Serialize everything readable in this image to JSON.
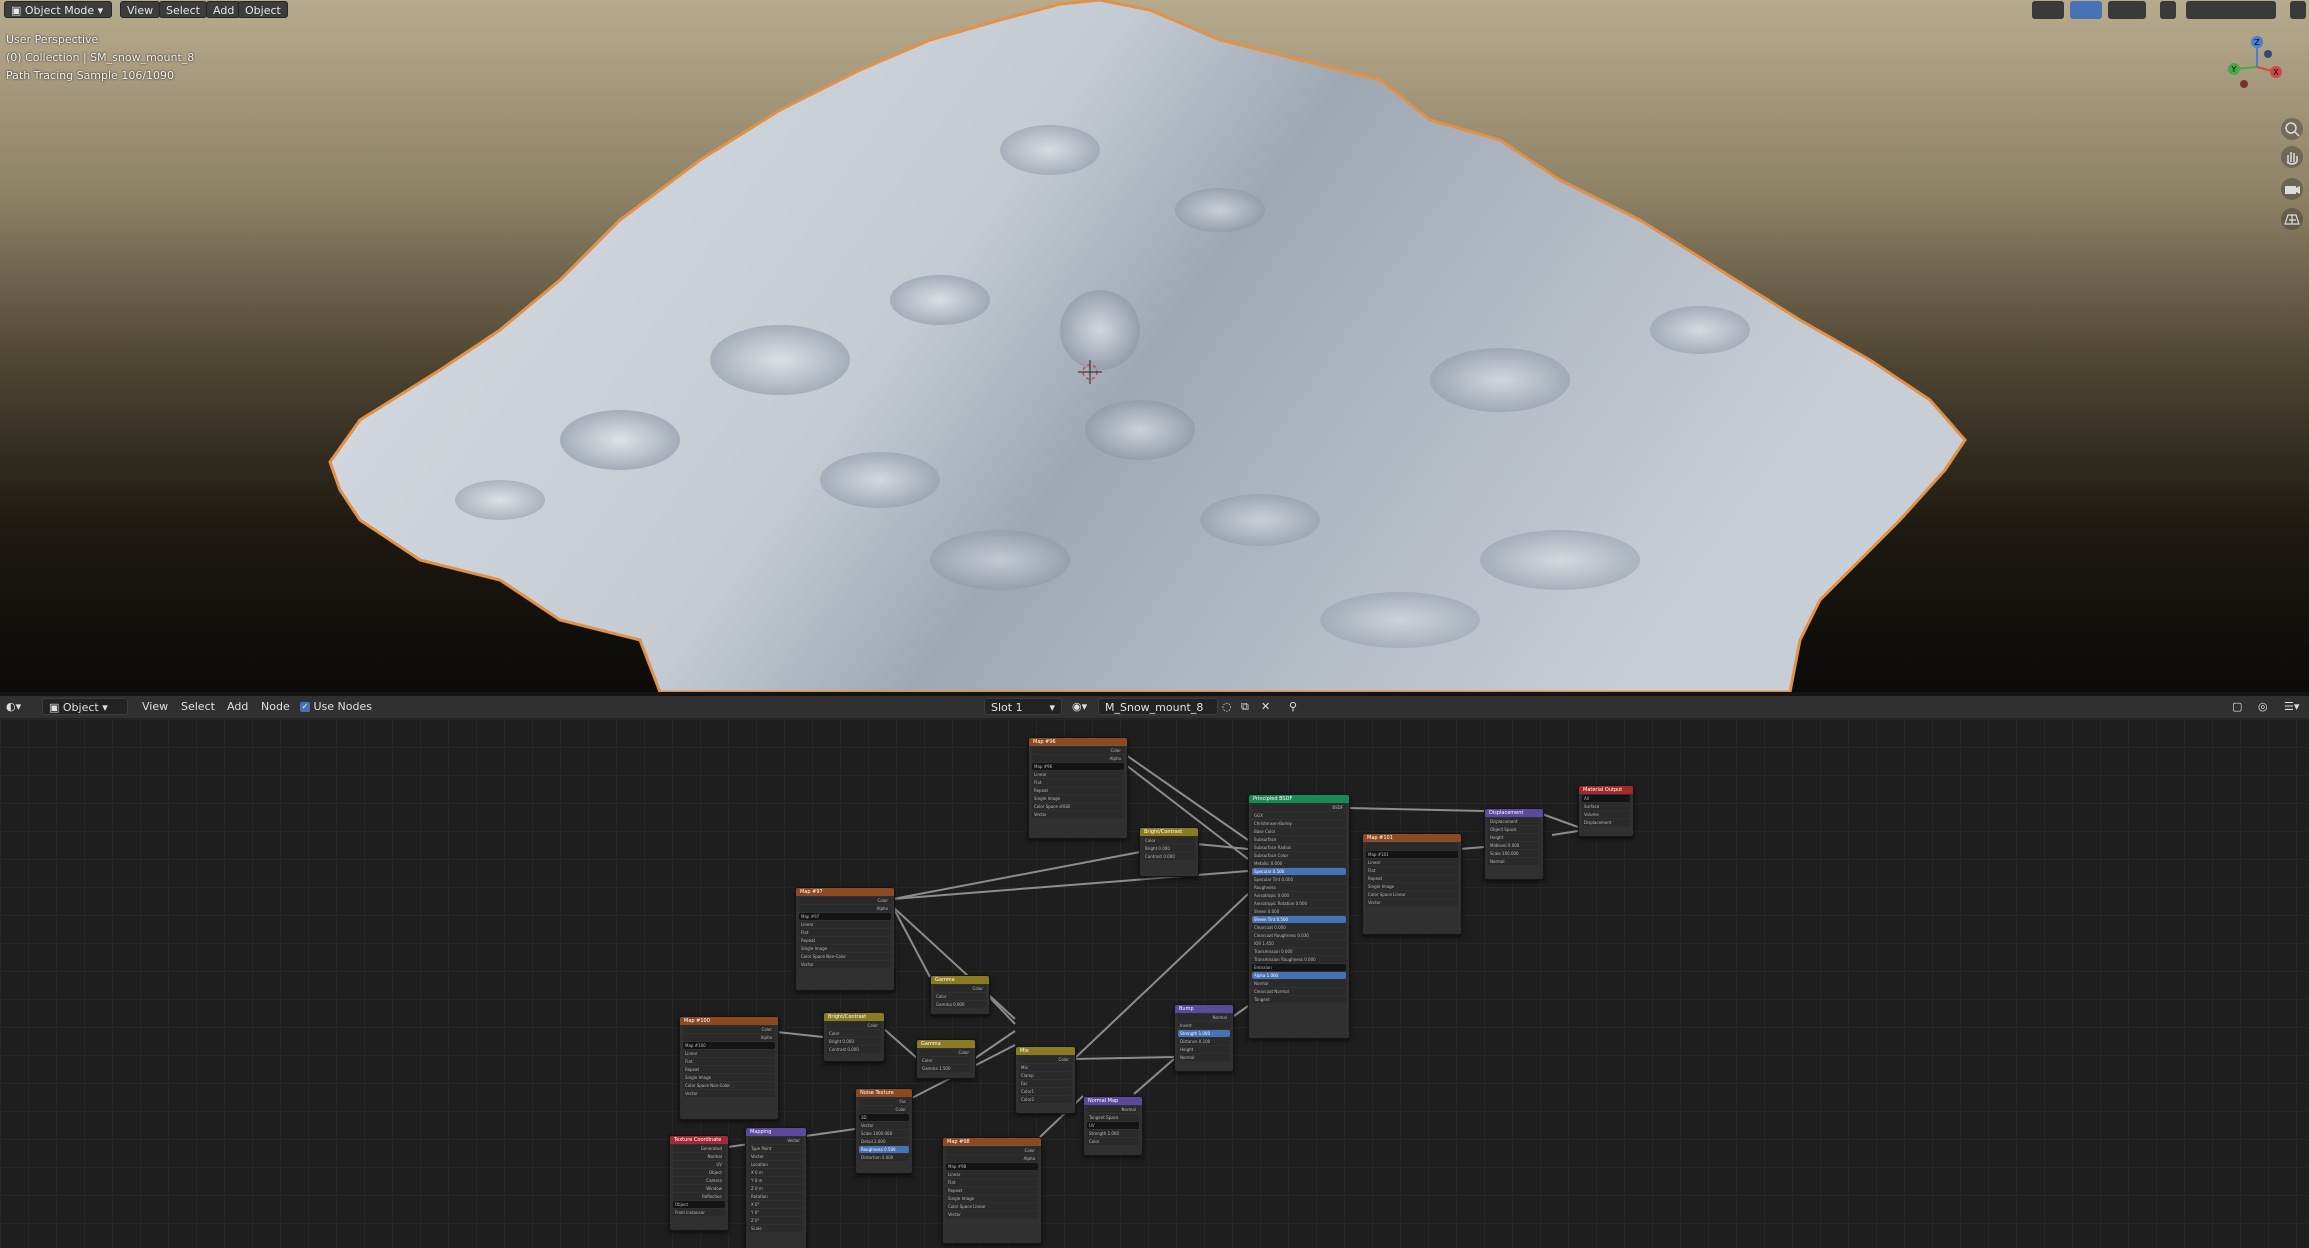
{
  "viewport_header": {
    "mode_label": "Object Mode",
    "menu": [
      "View",
      "Select",
      "Add",
      "Object"
    ]
  },
  "viewport_overlay": {
    "perspective": "User Perspective",
    "collection": "(0) Collection | SM_snow_mount_8",
    "render_status": "Path Tracing Sample 106/1090"
  },
  "gizmo": {
    "x": "X",
    "y": "Y",
    "z": "Z"
  },
  "node_header": {
    "object_label": "Object",
    "menu": [
      "View",
      "Select",
      "Add",
      "Node"
    ],
    "use_nodes_label": "Use Nodes",
    "use_nodes_checked": true,
    "slot_label": "Slot 1",
    "material_name": "M_Snow_mount_8"
  },
  "nodes": {
    "tex_top": {
      "title": "Map #96",
      "outputs": [
        "Color",
        "Alpha"
      ],
      "rows": [
        "Map #96",
        "Linear",
        "Flat",
        "Repeat",
        "Single Image",
        "Color Space  sRGB",
        "Vector"
      ]
    },
    "bright1": {
      "title": "Bright/Contrast",
      "rows": [
        "Color",
        "Bright  0.000",
        "Contrast  0.000"
      ]
    },
    "bsdf": {
      "title": "Principled BSDF",
      "rows": [
        "BSDF",
        "GGX",
        "Christensen-Burley",
        "Base Color",
        "Subsurface",
        "Subsurface Radius",
        "Subsurface Color",
        "Metallic  0.000",
        "Specular  0.500",
        "Specular Tint  0.000",
        "Roughness",
        "Anisotropic  0.000",
        "Anisotropic Rotation  0.000",
        "Sheen  0.000",
        "Sheen Tint  0.500",
        "Clearcoat  0.000",
        "Clearcoat Roughness  0.030",
        "IOR  1.450",
        "Transmission  0.000",
        "Transmission Roughness  0.000",
        "Emission",
        "Alpha  1.000",
        "Normal",
        "Clearcoat Normal",
        "Tangent"
      ]
    },
    "tex_disp": {
      "title": "Map #101",
      "rows": [
        "Map #101",
        "Linear",
        "Flat",
        "Repeat",
        "Single Image",
        "Color Space  Linear",
        "Vector"
      ]
    },
    "displacement": {
      "title": "Displacement",
      "rows": [
        "Displacement",
        "Object Space",
        "Height",
        "Midlevel  0.000",
        "Scale  100.000",
        "Normal"
      ]
    },
    "mat_output": {
      "title": "Material Output",
      "rows": [
        "All",
        "Surface",
        "Volume",
        "Displacement"
      ]
    },
    "tex_mid": {
      "title": "Map #97",
      "rows": [
        "Color",
        "Alpha",
        "Map #97",
        "Linear",
        "Flat",
        "Repeat",
        "Single Image",
        "Color Space  Non-Color",
        "Vector"
      ]
    },
    "gamma1": {
      "title": "Gamma",
      "rows": [
        "Color",
        "Color",
        "Gamma  0.000"
      ]
    },
    "tex_left": {
      "title": "Map #100",
      "rows": [
        "Color",
        "Alpha",
        "Map #100",
        "Linear",
        "Flat",
        "Repeat",
        "Single Image",
        "Color Space  Non-Color",
        "Vector"
      ]
    },
    "bright2": {
      "title": "Bright/Contrast",
      "rows": [
        "Color",
        "Color",
        "Bright  0.000",
        "Contrast  0.000"
      ]
    },
    "gamma2": {
      "title": "Gamma",
      "rows": [
        "Color",
        "Color",
        "Gamma  1.500"
      ]
    },
    "mix": {
      "title": "Mix",
      "rows": [
        "Color",
        "Mix",
        "Clamp",
        "Fac",
        "Color1",
        "Color2"
      ]
    },
    "bump": {
      "title": "Bump",
      "rows": [
        "Normal",
        "Invert",
        "Strength  1.000",
        "Distance  0.100",
        "Height",
        "Normal"
      ]
    },
    "normal_map": {
      "title": "Normal Map",
      "rows": [
        "Normal",
        "Tangent Space",
        "UV",
        "Strength  1.000",
        "Color"
      ]
    },
    "noise": {
      "title": "Noise Texture",
      "rows": [
        "Fac",
        "Color",
        "3D",
        "Vector",
        "Scale  1000.000",
        "Detail  2.000",
        "Roughness  0.500",
        "Distortion  0.000"
      ]
    },
    "texcoord": {
      "title": "Texture Coordinate",
      "rows": [
        "Generated",
        "Normal",
        "UV",
        "Object",
        "Camera",
        "Window",
        "Reflection",
        "Object",
        "From Instancer"
      ]
    },
    "mapping": {
      "title": "Mapping",
      "rows": [
        "Vector",
        "Type  Point",
        "Vector",
        "Location",
        "X  0 m",
        "Y  0 m",
        "Z  0 m",
        "Rotation",
        "X  0°",
        "Y  0°",
        "Z  0°",
        "Scale"
      ]
    },
    "tex_bottom": {
      "title": "Map #98",
      "rows": [
        "Color",
        "Alpha",
        "Map #98",
        "Linear",
        "Flat",
        "Repeat",
        "Single Image",
        "Color Space  Linear",
        "Vector"
      ]
    }
  }
}
